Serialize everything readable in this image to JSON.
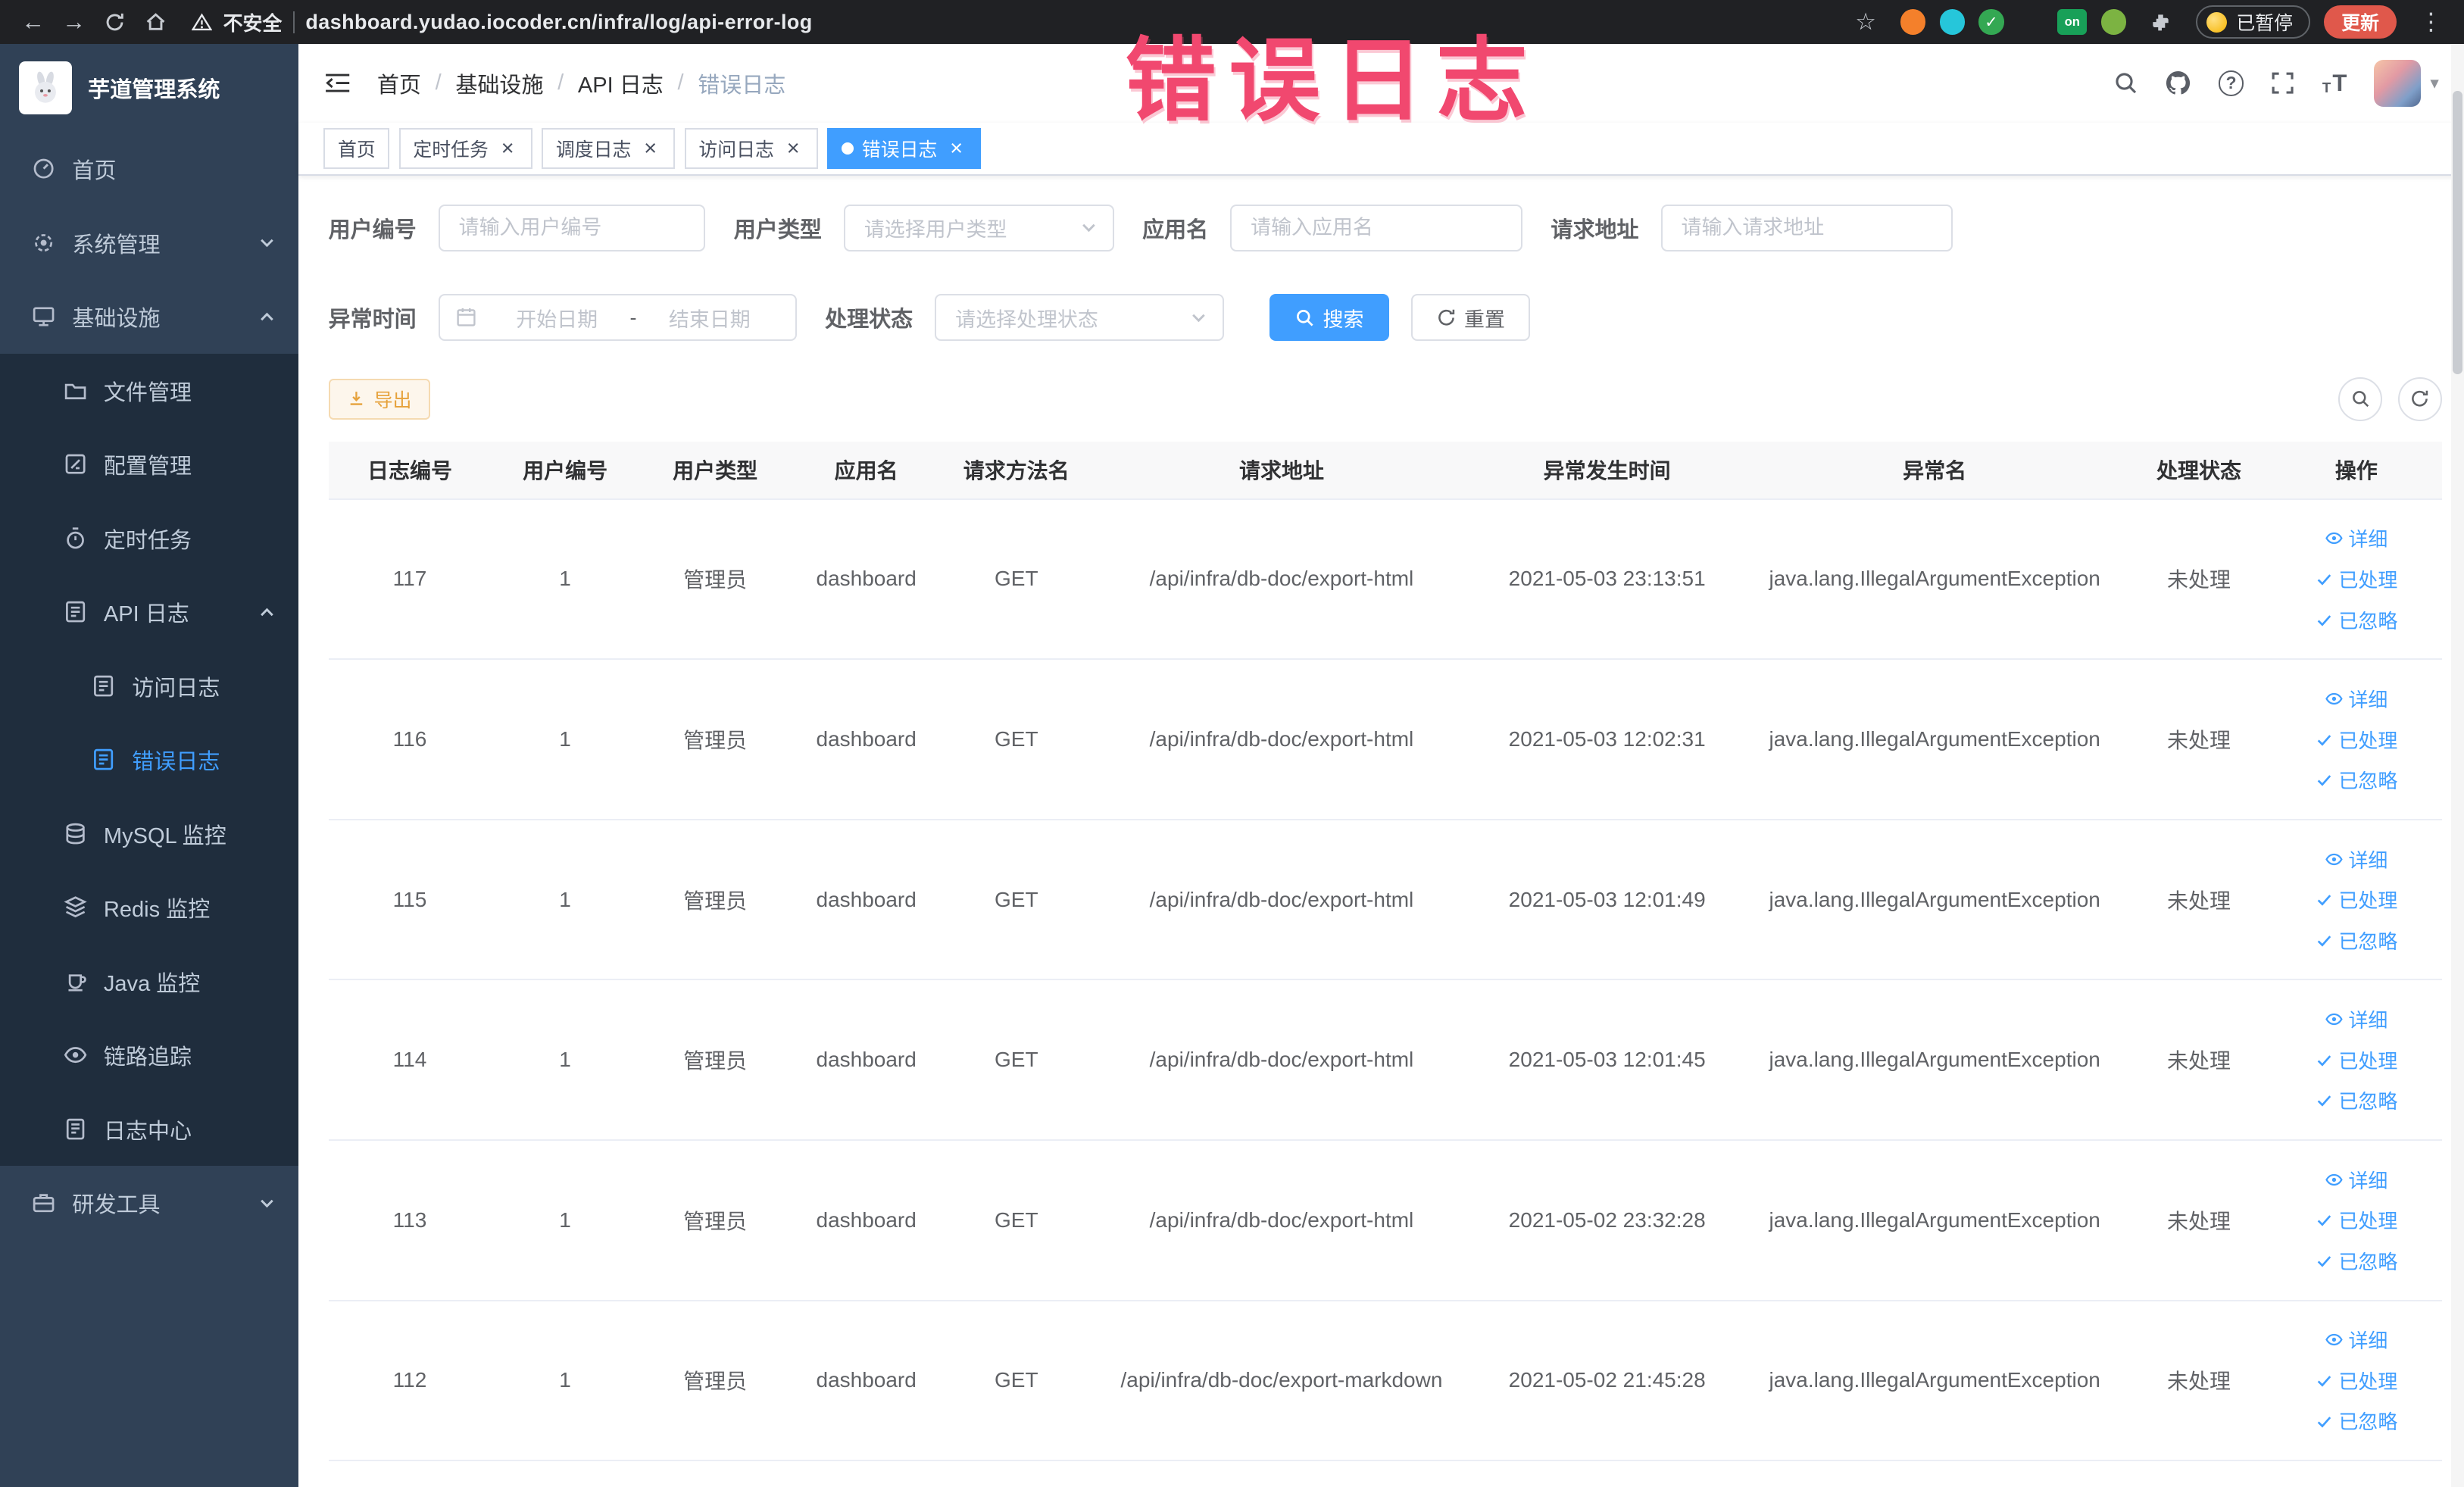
{
  "annotation": {
    "text": "错误日志"
  },
  "browser": {
    "security_label": "不安全",
    "url": "dashboard.yudao.iocoder.cn/infra/log/api-error-log",
    "on_badge": "on",
    "paused_badge": "已暂停",
    "update_button": "更新"
  },
  "sidebar": {
    "logo_title": "芋道管理系统",
    "menu": [
      {
        "key": "home",
        "label": "首页",
        "icon": "dashboard-icon",
        "level": 0
      },
      {
        "key": "system",
        "label": "系统管理",
        "icon": "gear-icon",
        "level": 0,
        "arrow": "down"
      },
      {
        "key": "infrastructure",
        "label": "基础设施",
        "icon": "infra-icon",
        "level": 0,
        "arrow": "up"
      },
      {
        "key": "file-manage",
        "label": "文件管理",
        "icon": "file-icon",
        "level": 1,
        "sub": true
      },
      {
        "key": "config-manage",
        "label": "配置管理",
        "icon": "config-icon",
        "level": 1,
        "sub": true
      },
      {
        "key": "scheduled-job",
        "label": "定时任务",
        "icon": "timer-icon",
        "level": 1,
        "sub": true
      },
      {
        "key": "api-log",
        "label": "API 日志",
        "icon": "api-log-icon",
        "level": 1,
        "sub": true,
        "arrow": "up"
      },
      {
        "key": "access-log",
        "label": "访问日志",
        "icon": "access-log-icon",
        "level": 2,
        "sub": true
      },
      {
        "key": "error-log",
        "label": "错误日志",
        "icon": "error-log-icon",
        "level": 2,
        "sub": true,
        "active": true
      },
      {
        "key": "mysql-monitor",
        "label": "MySQL 监控",
        "icon": "mysql-icon",
        "level": 1,
        "sub": true
      },
      {
        "key": "redis-monitor",
        "label": "Redis 监控",
        "icon": "redis-icon",
        "level": 1,
        "sub": true
      },
      {
        "key": "java-monitor",
        "label": "Java 监控",
        "icon": "java-icon",
        "level": 1,
        "sub": true
      },
      {
        "key": "trace",
        "label": "链路追踪",
        "icon": "trace-icon",
        "level": 1,
        "sub": true
      },
      {
        "key": "log-center",
        "label": "日志中心",
        "icon": "log-center-icon",
        "level": 1,
        "sub": true
      },
      {
        "key": "dev-tools",
        "label": "研发工具",
        "icon": "tools-icon",
        "level": 0,
        "arrow": "down"
      }
    ]
  },
  "header": {
    "breadcrumb": [
      "首页",
      "基础设施",
      "API 日志",
      "错误日志"
    ]
  },
  "tabs": [
    {
      "label": "首页",
      "closable": false,
      "active": false
    },
    {
      "label": "定时任务",
      "closable": true,
      "active": false
    },
    {
      "label": "调度日志",
      "closable": true,
      "active": false
    },
    {
      "label": "访问日志",
      "closable": true,
      "active": false
    },
    {
      "label": "错误日志",
      "closable": true,
      "active": true
    }
  ],
  "filters": {
    "user_id": {
      "label": "用户编号",
      "placeholder": "请输入用户编号"
    },
    "user_type": {
      "label": "用户类型",
      "placeholder": "请选择用户类型"
    },
    "app_name": {
      "label": "应用名",
      "placeholder": "请输入应用名"
    },
    "request_url": {
      "label": "请求地址",
      "placeholder": "请输入请求地址"
    },
    "exception_time": {
      "label": "异常时间",
      "start_placeholder": "开始日期",
      "separator": "-",
      "end_placeholder": "结束日期"
    },
    "process_status": {
      "label": "处理状态",
      "placeholder": "请选择处理状态"
    },
    "search_button": "搜索",
    "reset_button": "重置"
  },
  "toolbar": {
    "export_button": "导出"
  },
  "table": {
    "columns": [
      "日志编号",
      "用户编号",
      "用户类型",
      "应用名",
      "请求方法名",
      "请求地址",
      "异常发生时间",
      "异常名",
      "处理状态",
      "操作"
    ],
    "actions": [
      "详细",
      "已处理",
      "已忽略"
    ],
    "rows": [
      {
        "id": "117",
        "user_id": "1",
        "user_type": "管理员",
        "app": "dashboard",
        "method": "GET",
        "url": "/api/infra/db-doc/export-html",
        "time": "2021-05-03 23:13:51",
        "exception": "java.lang.IllegalArgumentException",
        "status": "未处理"
      },
      {
        "id": "116",
        "user_id": "1",
        "user_type": "管理员",
        "app": "dashboard",
        "method": "GET",
        "url": "/api/infra/db-doc/export-html",
        "time": "2021-05-03 12:02:31",
        "exception": "java.lang.IllegalArgumentException",
        "status": "未处理"
      },
      {
        "id": "115",
        "user_id": "1",
        "user_type": "管理员",
        "app": "dashboard",
        "method": "GET",
        "url": "/api/infra/db-doc/export-html",
        "time": "2021-05-03 12:01:49",
        "exception": "java.lang.IllegalArgumentException",
        "status": "未处理"
      },
      {
        "id": "114",
        "user_id": "1",
        "user_type": "管理员",
        "app": "dashboard",
        "method": "GET",
        "url": "/api/infra/db-doc/export-html",
        "time": "2021-05-03 12:01:45",
        "exception": "java.lang.IllegalArgumentException",
        "status": "未处理"
      },
      {
        "id": "113",
        "user_id": "1",
        "user_type": "管理员",
        "app": "dashboard",
        "method": "GET",
        "url": "/api/infra/db-doc/export-html",
        "time": "2021-05-02 23:32:28",
        "exception": "java.lang.IllegalArgumentException",
        "status": "未处理"
      },
      {
        "id": "112",
        "user_id": "1",
        "user_type": "管理员",
        "app": "dashboard",
        "method": "GET",
        "url": "/api/infra/db-doc/export-markdown",
        "time": "2021-05-02 21:45:28",
        "exception": "java.lang.IllegalArgumentException",
        "status": "未处理"
      }
    ]
  },
  "colors": {
    "primary": "#409eff",
    "sidebar_bg": "#304156",
    "submenu_bg": "#1f2d3d",
    "annotation": "#f1486f",
    "export_text": "#e6a23c"
  }
}
